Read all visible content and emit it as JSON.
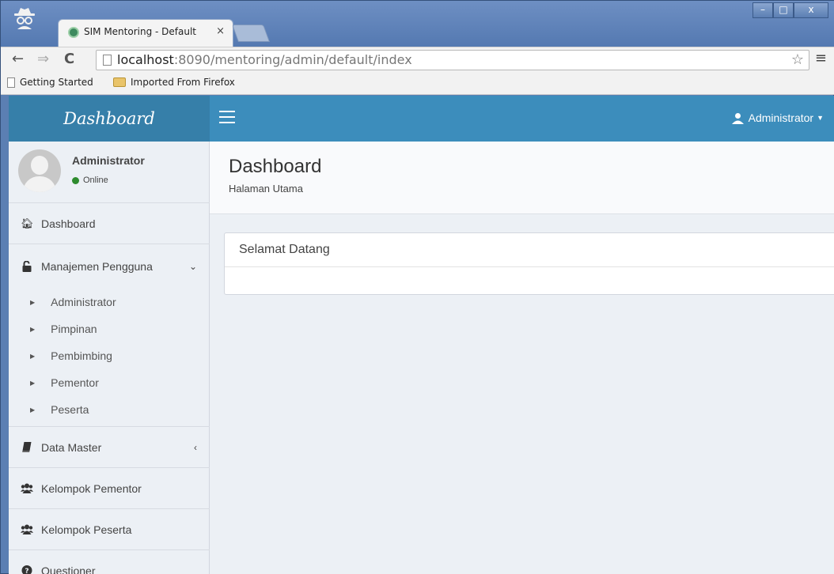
{
  "browser": {
    "tab_title": "SIM Mentoring - Default",
    "tab_close": "×",
    "url_host": "localhost",
    "url_rest": ":8090/mentoring/admin/default/index",
    "bookmarks": [
      "Getting Started",
      "Imported From Firefox"
    ],
    "window_buttons": [
      "–",
      "□",
      "x"
    ]
  },
  "app": {
    "logo": "Dashboard",
    "top_user": "Administrator",
    "user_panel": {
      "name": "Administrator",
      "status": "Online"
    },
    "menu": [
      {
        "label": "Dashboard",
        "icon": "home-icon"
      },
      {
        "label": "Manajemen Pengguna",
        "icon": "unlock-icon",
        "expanded": true,
        "children": [
          "Administrator",
          "Pimpinan",
          "Pembimbing",
          "Pementor",
          "Peserta"
        ]
      },
      {
        "label": "Data Master",
        "icon": "book-icon",
        "expanded": false
      },
      {
        "label": "Kelompok Pementor",
        "icon": "users-icon"
      },
      {
        "label": "Kelompok Peserta",
        "icon": "users-icon"
      },
      {
        "label": "Questioner",
        "icon": "question-icon"
      }
    ],
    "page_title": "Dashboard",
    "page_subtitle": "Halaman Utama",
    "box_title": "Selamat Datang"
  },
  "colors": {
    "header_dark": "#367fa9",
    "header": "#3c8dbc",
    "sidebar_bg": "#ecf0f5",
    "online": "#2e8b2e"
  }
}
